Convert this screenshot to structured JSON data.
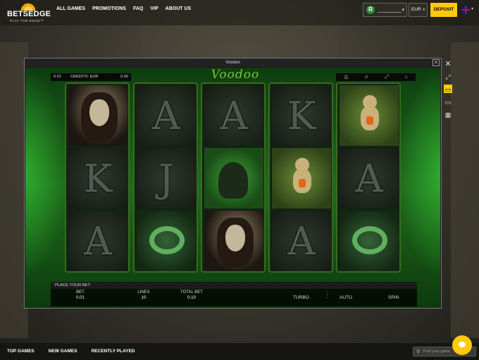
{
  "header": {
    "logo": {
      "brand": "BETSEDGE",
      "tagline": "PLAY THE EDGE™"
    },
    "nav": [
      "ALL GAMES",
      "PROMOTIONS",
      "FAQ",
      "VIP",
      "ABOUT US"
    ],
    "wallet_badge": "R",
    "currency": "EUR",
    "deposit_label": "DEPOSIT",
    "language_icon": "uk-flag-icon"
  },
  "game_window": {
    "title": "Voodoo",
    "close_label": "×",
    "info": {
      "value1": "0.01",
      "credits_label": "CREDITS: EUR",
      "credits_value": "0.00"
    },
    "logo_text": "Voodoo",
    "controls": [
      "menu-icon",
      "sound-icon",
      "fullscreen-icon",
      "home-icon"
    ],
    "bottom": {
      "place_bet": "PLACE YOUR BET",
      "bet_label": "BET",
      "bet_value": "0.01",
      "lines_label": "LINES",
      "lines_value": "10",
      "total_label": "TOTAL BET",
      "total_value": "0.10",
      "turbo": "TURBO",
      "auto": "AUTO",
      "spin": "SPIN"
    },
    "reels": [
      [
        "woman",
        "K",
        "A"
      ],
      [
        "A",
        "J",
        "snake"
      ],
      [
        "A",
        "raven",
        "woman"
      ],
      [
        "K",
        "doll",
        "A"
      ],
      [
        "doll",
        "A",
        "snake"
      ]
    ]
  },
  "side_controls": [
    "close-icon",
    "expand-icon",
    "desktop-icon",
    "monitor-icon",
    "grid-icon"
  ],
  "footer": {
    "nav": [
      "TOP GAMES",
      "NEW GAMES",
      "RECENTLY PLAYED"
    ],
    "search_placeholder": "Find your game"
  },
  "colors": {
    "accent": "#ffca0a",
    "game_green": "#1f6b1c"
  }
}
